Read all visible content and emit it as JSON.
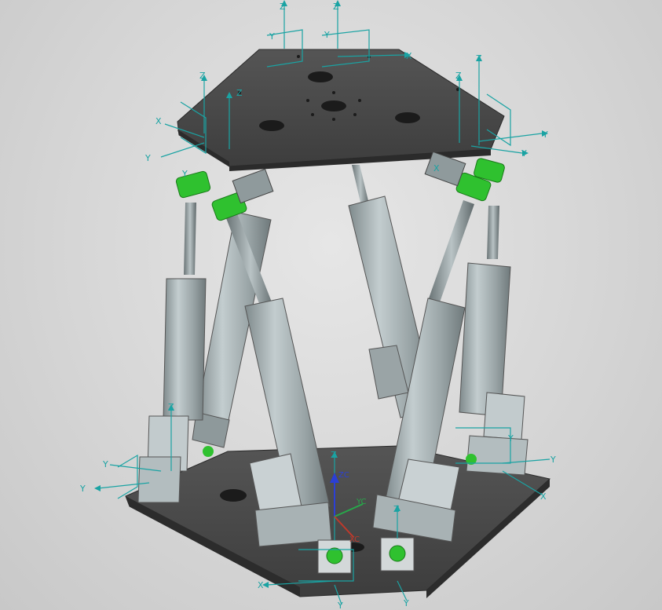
{
  "viewport": {
    "background": "#d8d8d8",
    "colors": {
      "axis": "#1aa3a3",
      "wcs_z": "#2b3fd6",
      "wcs_x": "#c0392b",
      "wcs_y": "#27a84a",
      "joint": "#2fc12f",
      "plate": "#474747",
      "actuator": "#a9b4b6"
    },
    "wcs": {
      "z_label": "ZC",
      "x_label": "XC",
      "y_label": "YC"
    },
    "csys_labels": {
      "top_z1": "Z",
      "top_z2": "Z",
      "top_y1": "Y",
      "top_y2": "Y",
      "top_x": "X",
      "left_z1": "Z",
      "left_z2": "Z",
      "left_x": "X",
      "left_y1": "Y",
      "left_y2": "Y",
      "right_z1": "Z",
      "right_z2": "Z",
      "right_y1": "Y",
      "right_y2": "Y",
      "right_x": "X",
      "bl_z": "Z",
      "bl_y1": "Y",
      "bl_y2": "Y",
      "br_y1": "Y",
      "br_y2": "Y",
      "br_x": "X",
      "bc_z1": "Z",
      "bc_z2": "Z",
      "bc_x": "X",
      "bc_y1": "Y",
      "bc_y2": "Y"
    }
  }
}
